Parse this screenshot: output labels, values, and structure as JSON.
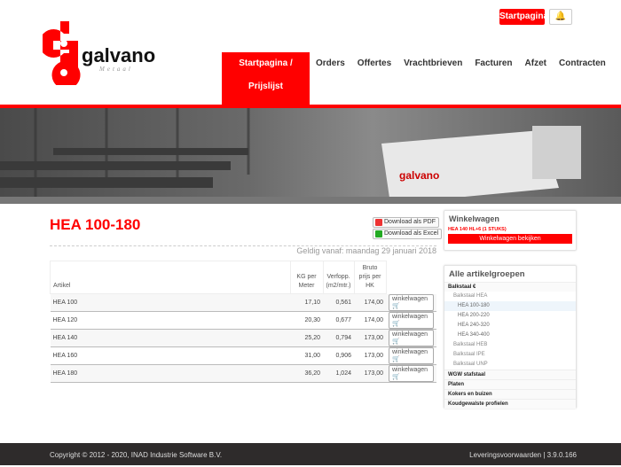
{
  "header": {
    "top_button": "Startpagina",
    "bell_icon": "bell-icon",
    "logo_text": "galvano",
    "logo_sub": "Metaal",
    "nav": [
      "Startpagina / Prijslijst",
      "Orders",
      "Offertes",
      "Vrachtbrieven",
      "Facturen",
      "Afzet",
      "Contracten"
    ]
  },
  "main": {
    "title": "HEA 100-180",
    "download_pdf": "Download als PDF",
    "download_excel": "Download als Excel",
    "valid_from": "Geldig vanaf: maandag 29 januari 2018",
    "columns": [
      "Artikel",
      "KG per Meter",
      "Verfopp. (m2/mtr.)",
      "Bruto prijs per HK"
    ],
    "rows": [
      [
        "HEA 100",
        "17,10",
        "0,561",
        "174,00"
      ],
      [
        "HEA 120",
        "20,30",
        "0,677",
        "174,00"
      ],
      [
        "HEA 140",
        "25,20",
        "0,794",
        "173,00"
      ],
      [
        "HEA 160",
        "31,00",
        "0,906",
        "173,00"
      ],
      [
        "HEA 180",
        "36,20",
        "1,024",
        "173,00"
      ]
    ],
    "cart_button": "winkelwagen"
  },
  "cart": {
    "title": "Winkelwagen",
    "item": "HEA 140 HL+6 (1 STUKS)",
    "view_button": "Winkelwagen bekijken"
  },
  "groups": {
    "title": "Alle artikelgroepen",
    "items": [
      {
        "label": "Balkstaal €",
        "level": 0
      },
      {
        "label": "Balkstaal HEA",
        "level": 1
      },
      {
        "label": "HEA 100-180",
        "level": 2,
        "selected": true
      },
      {
        "label": "HEA 200-220",
        "level": 2
      },
      {
        "label": "HEA 240-320",
        "level": 2
      },
      {
        "label": "HEA 340-400",
        "level": 2
      },
      {
        "label": "Balkstaal HEB",
        "level": 1
      },
      {
        "label": "Balkstaal IPE",
        "level": 1
      },
      {
        "label": "Balkstaal UNP",
        "level": 1
      },
      {
        "label": "WGW stafstaal",
        "level": 0
      },
      {
        "label": "Platen",
        "level": 0
      },
      {
        "label": "Kokers en buizen",
        "level": 0
      },
      {
        "label": "Koudgewalste profielen",
        "level": 0
      }
    ]
  },
  "footer": {
    "copyright": "Copyright © 2012 - 2020, INAD Industrie Software B.V.",
    "right": "Leveringsvoorwaarden | 3.9.0.166"
  },
  "colors": {
    "accent": "#ff0000",
    "footer": "#2e2b2b"
  }
}
